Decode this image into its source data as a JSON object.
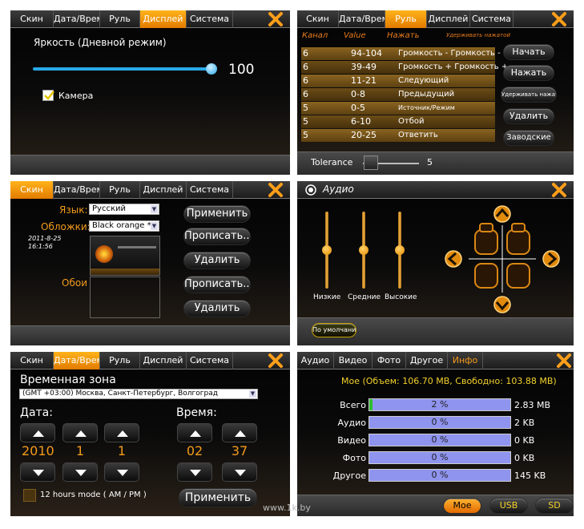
{
  "colors": {
    "accent": "#f39a1c",
    "active_tab": "#ff9e1a",
    "slider_blue": "#29a9e8"
  },
  "panel1": {
    "tabs": [
      "Скин",
      "Дата/Время",
      "Руль",
      "Дисплей",
      "Система"
    ],
    "active_tab": "Дисплей",
    "brightness_label": "Яркость (Дневной режим)",
    "brightness_value": "100",
    "brightness_level": 100,
    "camera_label": "Камера",
    "camera_checked": true
  },
  "panel2": {
    "tabs": [
      "Скин",
      "Дата/Время",
      "Руль",
      "Дисплей",
      "Система"
    ],
    "active_tab": "Руль",
    "headers": {
      "channel": "Канал",
      "value": "Value",
      "press": "Нажать",
      "hold": "Удерживать нажатой"
    },
    "rows": [
      {
        "ch": "6",
        "val": "94-104",
        "act": "Громкость - Громкость -"
      },
      {
        "ch": "6",
        "val": "39-49",
        "act": "Громкость + Громкость +"
      },
      {
        "ch": "6",
        "val": "11-21",
        "act": "Следующий"
      },
      {
        "ch": "6",
        "val": "0-8",
        "act": "Предыдущий"
      },
      {
        "ch": "5",
        "val": "0-5",
        "act": "Источник/Режим"
      },
      {
        "ch": "5",
        "val": "6-10",
        "act": "Отбой"
      },
      {
        "ch": "5",
        "val": "20-25",
        "act": "Ответить"
      }
    ],
    "buttons": [
      "Начать",
      "Нажать",
      "Удерживать нажатой",
      "Удалить",
      "Заводские"
    ],
    "tolerance_label": "Tolerance",
    "tolerance_value": "5"
  },
  "panel3": {
    "tabs": [
      "Скин",
      "Дата/Время",
      "Руль",
      "Дисплей",
      "Система"
    ],
    "active_tab": "Скин",
    "language_label": "Язык:",
    "language_value": "Русский",
    "skins_label": "Обложки:",
    "skins_value": "Black orange *",
    "date": "2011-8-25",
    "time": "16:1:56",
    "wallpaper_label": "Обои",
    "buttons": [
      "Применить",
      "Прописать...",
      "Удалить",
      "Прописать...",
      "Удалить"
    ]
  },
  "panel4": {
    "title": "Аудио",
    "sliders": [
      {
        "label": "Низкие",
        "level": 0.5
      },
      {
        "label": "Средние",
        "level": 0.5
      },
      {
        "label": "Высокие",
        "level": 0.5
      }
    ],
    "default_button": "По умолчанию"
  },
  "panel5": {
    "tabs": [
      "Скин",
      "Дата/Время",
      "Руль",
      "Дисплей",
      "Система"
    ],
    "active_tab": "Дата/Время",
    "timezone_label": "Временная зона",
    "timezone_value": "(GMT +03:00) Москва, Санкт-Петербург, Волгоград",
    "date_label": "Дата:",
    "time_label": "Время:",
    "year": "2010",
    "month": "1",
    "day": "1",
    "hour": "02",
    "minute": "37",
    "hours12_label": "12 hours mode ( AM / PM )",
    "apply_button": "Применить"
  },
  "panel6": {
    "tabs": [
      "Аудио",
      "Видео",
      "Фото",
      "Другое",
      "Инфо"
    ],
    "active_tab": "Инфо",
    "summary": "Мое (Объем: 106.70 MB, Свободно: 103.88 MB)",
    "rows": [
      {
        "label": "Всего",
        "percent": "2 %",
        "fill": 0.02,
        "size": "2.83 MB"
      },
      {
        "label": "Аудио",
        "percent": "0 %",
        "fill": 0,
        "size": "2 KB"
      },
      {
        "label": "Видео",
        "percent": "0 %",
        "fill": 0,
        "size": "0 KB"
      },
      {
        "label": "Фото",
        "percent": "0 %",
        "fill": 0,
        "size": "0 KB"
      },
      {
        "label": "Другое",
        "percent": "0 %",
        "fill": 0,
        "size": "145 KB"
      }
    ],
    "buttons": [
      "Мое",
      "USB",
      "SD"
    ],
    "active_button": "Мое"
  },
  "watermark": "www.1k.by"
}
